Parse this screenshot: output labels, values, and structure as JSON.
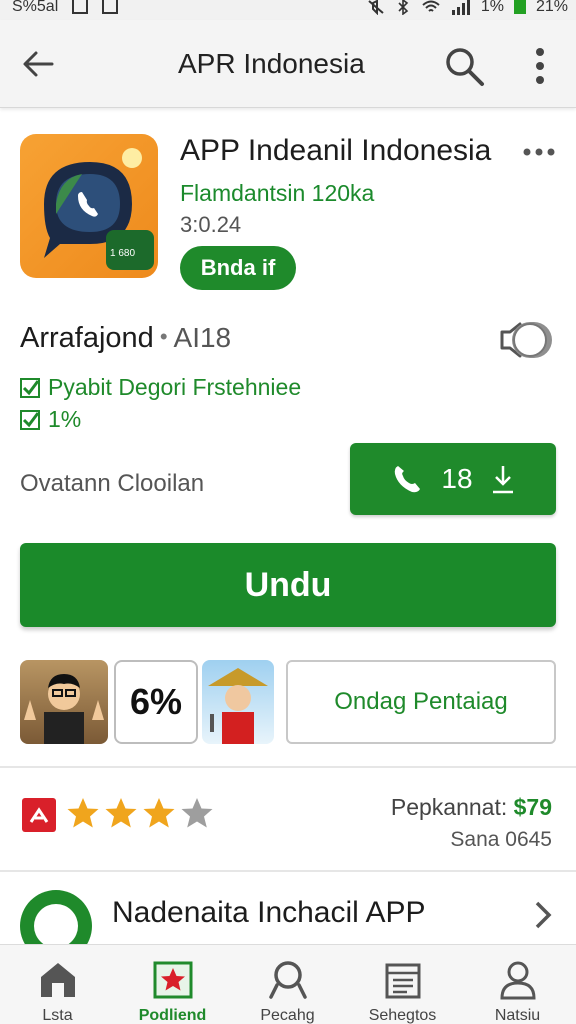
{
  "status_bar": {
    "left_text": "S%5al",
    "right_text": "1%",
    "battery_text": "21%"
  },
  "app_bar": {
    "title": "APR Indonesia"
  },
  "app": {
    "name": "APP Indeanil Indonesia",
    "developer": "Flamdantsin 120ka",
    "version": "3:0.24",
    "pill_label": "Bnda if",
    "icon_badge_text": "1 680"
  },
  "rating_row": {
    "label": "Arrafajond",
    "code": "AI18"
  },
  "features": [
    "Pyabit Degori Frstehniee",
    "1%"
  ],
  "collection_label": "Ovatann Clooilan",
  "call_button": {
    "label": "18"
  },
  "install_button": {
    "label": "Undu"
  },
  "media_row": {
    "percent": "6%",
    "review_button_label": "Ondag Pentaiag"
  },
  "rating": {
    "stars_filled": 3,
    "stars_total": 4,
    "price_label": "Pepkannat:",
    "price_value": "$79",
    "sana_text": "Sana 0645"
  },
  "promo": {
    "text": "Nadenaita Inchacil APP"
  },
  "bottom_nav": [
    {
      "label": "Lsta",
      "icon": "store-icon"
    },
    {
      "label": "Podliend",
      "icon": "star-map-icon"
    },
    {
      "label": "Pecahg",
      "icon": "search-icon"
    },
    {
      "label": "Sehegtos",
      "icon": "calendar-icon"
    },
    {
      "label": "Natsiu",
      "icon": "person-icon"
    }
  ],
  "colors": {
    "accent_green": "#1f8a2b",
    "red_badge": "#d9202a",
    "star_gold": "#f0a51d",
    "star_gray": "#9e9e9e",
    "icon_orange": "#f7a234"
  }
}
